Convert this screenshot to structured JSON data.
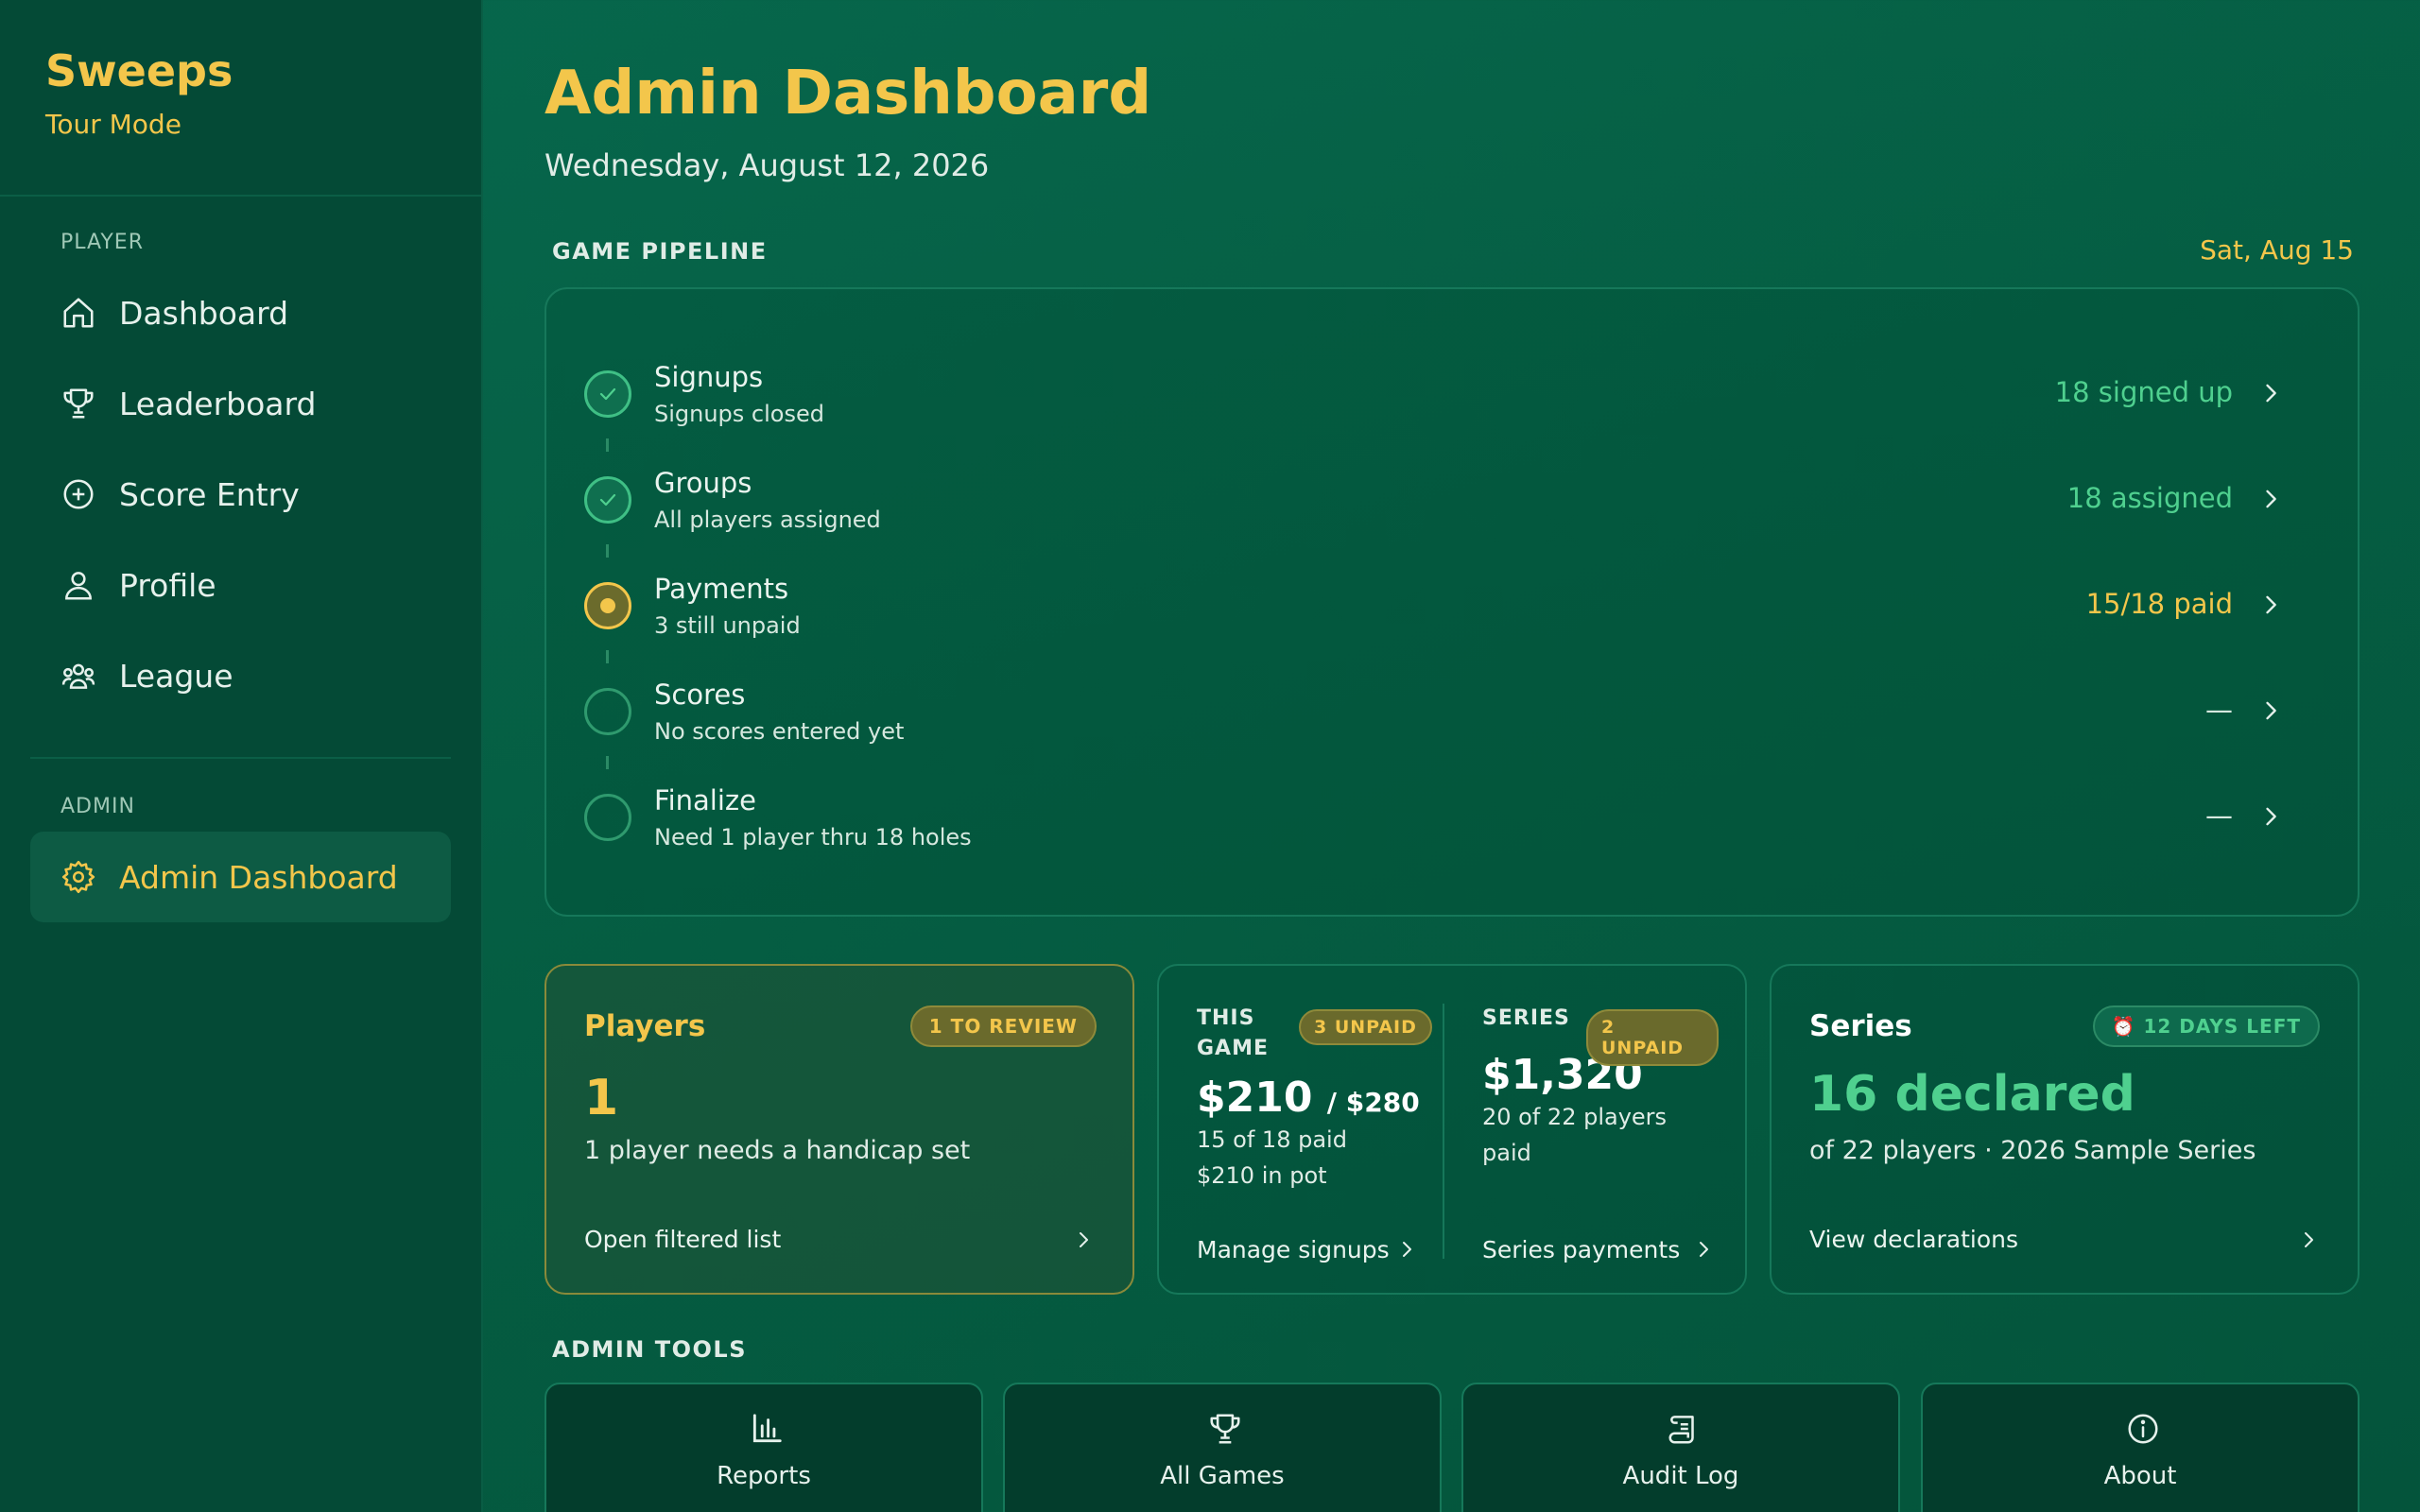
{
  "app": {
    "name": "Sweeps",
    "mode": "Tour Mode"
  },
  "sidebar": {
    "player_label": "PLAYER",
    "player_items": [
      {
        "label": "Dashboard",
        "icon": "home-icon"
      },
      {
        "label": "Leaderboard",
        "icon": "trophy-icon"
      },
      {
        "label": "Score Entry",
        "icon": "plus-circle-icon"
      },
      {
        "label": "Profile",
        "icon": "user-icon"
      },
      {
        "label": "League",
        "icon": "users-icon"
      }
    ],
    "admin_label": "ADMIN",
    "admin_items": [
      {
        "label": "Admin Dashboard",
        "icon": "gear-icon",
        "active": true
      }
    ]
  },
  "header": {
    "title": "Admin Dashboard",
    "date": "Wednesday, August 12, 2026"
  },
  "pipeline": {
    "heading": "GAME PIPELINE",
    "game_date": "Sat, Aug 15",
    "steps": [
      {
        "name": "Signups",
        "sub": "Signups closed",
        "value": "18 signed up",
        "status": "done"
      },
      {
        "name": "Groups",
        "sub": "All players assigned",
        "value": "18 assigned",
        "status": "done"
      },
      {
        "name": "Payments",
        "sub": "3 still unpaid",
        "value": "15/18 paid",
        "status": "current"
      },
      {
        "name": "Scores",
        "sub": "No scores entered yet",
        "value": "—",
        "status": "pending"
      },
      {
        "name": "Finalize",
        "sub": "Need 1 player thru 18 holes",
        "value": "—",
        "status": "pending"
      }
    ]
  },
  "players_card": {
    "title": "Players",
    "badge": "1 TO REVIEW",
    "count": "1",
    "desc": "1 player needs a handicap set",
    "link": "Open filtered list"
  },
  "payments_card": {
    "game": {
      "label_line1": "THIS",
      "label_line2": "GAME",
      "badge": "3 UNPAID",
      "amount": "$210",
      "amount_total": "/ $280",
      "paid": "15 of 18 paid",
      "pot": "$210 in pot",
      "link": "Manage signups"
    },
    "series": {
      "label": "SERIES",
      "badge": "2 UNPAID",
      "amount": "$1,320",
      "paid": "20 of 22 players paid",
      "link": "Series payments"
    }
  },
  "series_card": {
    "title": "Series",
    "badge": "⏰ 12 DAYS LEFT",
    "count": "16 declared",
    "desc": "of 22 players · 2026 Sample Series",
    "link": "View declarations"
  },
  "tools": {
    "heading": "ADMIN TOOLS",
    "items": [
      {
        "label": "Reports",
        "icon": "bar-chart-icon"
      },
      {
        "label": "All Games",
        "icon": "trophy-icon"
      },
      {
        "label": "Audit Log",
        "icon": "scroll-icon"
      },
      {
        "label": "About",
        "icon": "info-icon"
      }
    ]
  },
  "colors": {
    "accent_gold": "#f3c64b",
    "success_green": "#4fd08f",
    "background": "#055e43"
  }
}
